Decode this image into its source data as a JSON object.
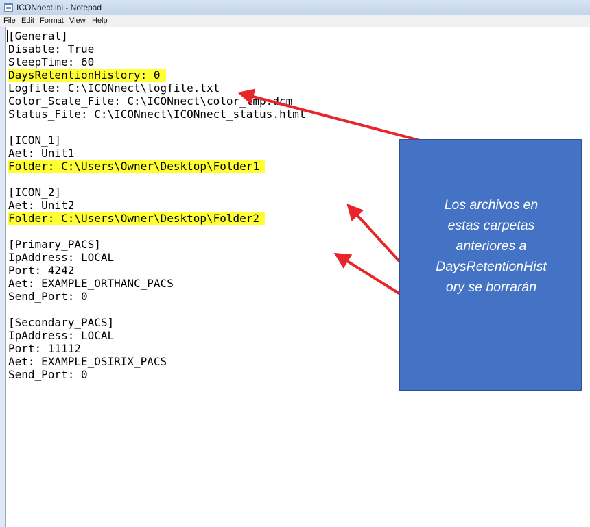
{
  "window": {
    "title": "ICONnect.ini - Notepad"
  },
  "menu": {
    "items": [
      "File",
      "Edit",
      "Format",
      "View",
      "Help"
    ]
  },
  "editor": {
    "lines": [
      "[General]",
      "Disable: True",
      "SleepTime: 60",
      "DaysRetentionHistory: 0",
      "Logfile: C:\\ICONnect\\logfile.txt",
      "Color_Scale_File: C:\\ICONnect\\color_tmp.dcm",
      "Status_File: C:\\ICONnect\\ICONnect_status.html",
      "",
      "[ICON_1]",
      "Aet: Unit1",
      "Folder: C:\\Users\\Owner\\Desktop\\Folder1",
      "",
      "[ICON_2]",
      "Aet: Unit2",
      "Folder: C:\\Users\\Owner\\Desktop\\Folder2",
      "",
      "[Primary_PACS]",
      "IpAddress: LOCAL",
      "Port: 4242",
      "Aet: EXAMPLE_ORTHANC_PACS",
      "Send_Port: 0",
      "",
      "[Secondary_PACS]",
      "IpAddress: LOCAL",
      "Port: 11112",
      "Aet: EXAMPLE_OSIRIX_PACS",
      "Send_Port: 0"
    ],
    "highlight_color": "#ffff33"
  },
  "annotation": {
    "text": "Los archivos en estas carpetas anteriores a DaysRetentionHistory se borrarán",
    "text_lines": [
      "Los archivos en",
      "estas carpetas",
      "anteriores a",
      "DaysRetentionHist",
      "ory se borrarán"
    ],
    "box_color": "#4472c4",
    "arrow_color": "#e8262a"
  }
}
